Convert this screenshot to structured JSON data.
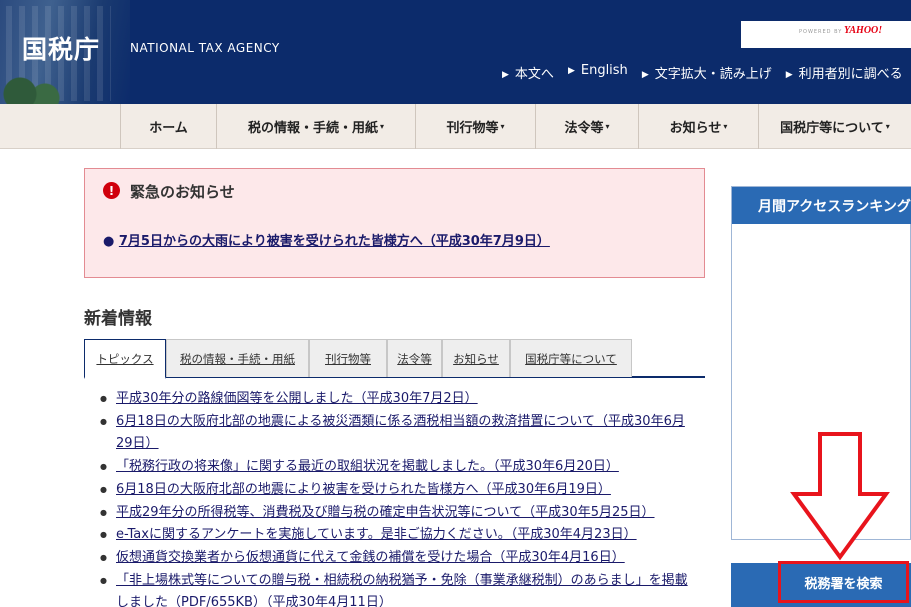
{
  "header": {
    "logo_text": "国税庁",
    "logo_en": "NATIONAL TAX AGENCY",
    "search_powered": "POWERED BY",
    "search_brand": "YAHOO!",
    "util_links": [
      "本文へ",
      "English",
      "文字拡大・読み上げ",
      "利用者別に調べる"
    ]
  },
  "nav": {
    "items": [
      "ホーム",
      "税の情報・手続・用紙",
      "刊行物等",
      "法令等",
      "お知らせ",
      "国税庁等について"
    ],
    "dropdown_marker": "▾"
  },
  "emergency": {
    "icon": "!",
    "title": "緊急のお知らせ",
    "link": "7月5日からの大雨により被害を受けられた皆様方へ（平成30年7月9日）"
  },
  "news": {
    "heading": "新着情報",
    "tabs": [
      "トピックス",
      "税の情報・手続・用紙",
      "刊行物等",
      "法令等",
      "お知らせ",
      "国税庁等について"
    ],
    "items": [
      "平成30年分の路線価図等を公開しました（平成30年7月2日）",
      "6月18日の大阪府北部の地震による被災酒類に係る酒税相当額の救済措置について（平成30年6月29日）",
      "「税務行政の将来像」に関する最近の取組状況を掲載しました。（平成30年6月20日）",
      "6月18日の大阪府北部の地震により被害を受けられた皆様方へ（平成30年6月19日）",
      "平成29年分の所得税等、消費税及び贈与税の確定申告状況等について（平成30年5月25日）",
      "e-Taxに関するアンケートを実施しています。是非ご協力ください。（平成30年4月23日）",
      "仮想通貨交換業者から仮想通貨に代えて金銭の補償を受けた場合（平成30年4月16日）",
      "「非上場株式等についての贈与税・相続税の納税猶予・免除（事業承継税制）のあらまし」を掲載しました（PDF/655KB）（平成30年4月11日）"
    ]
  },
  "side": {
    "ranking_title": "月間アクセスランキング",
    "office_search": "税務署を検索"
  },
  "colors": {
    "header_bg": "#0c2b6b",
    "nav_bg": "#f2ece6",
    "emergency_bg": "#fde8ea",
    "emergency_icon": "#d0000c",
    "side_head": "#2a6ab4",
    "annotation_red": "#e8141c"
  }
}
